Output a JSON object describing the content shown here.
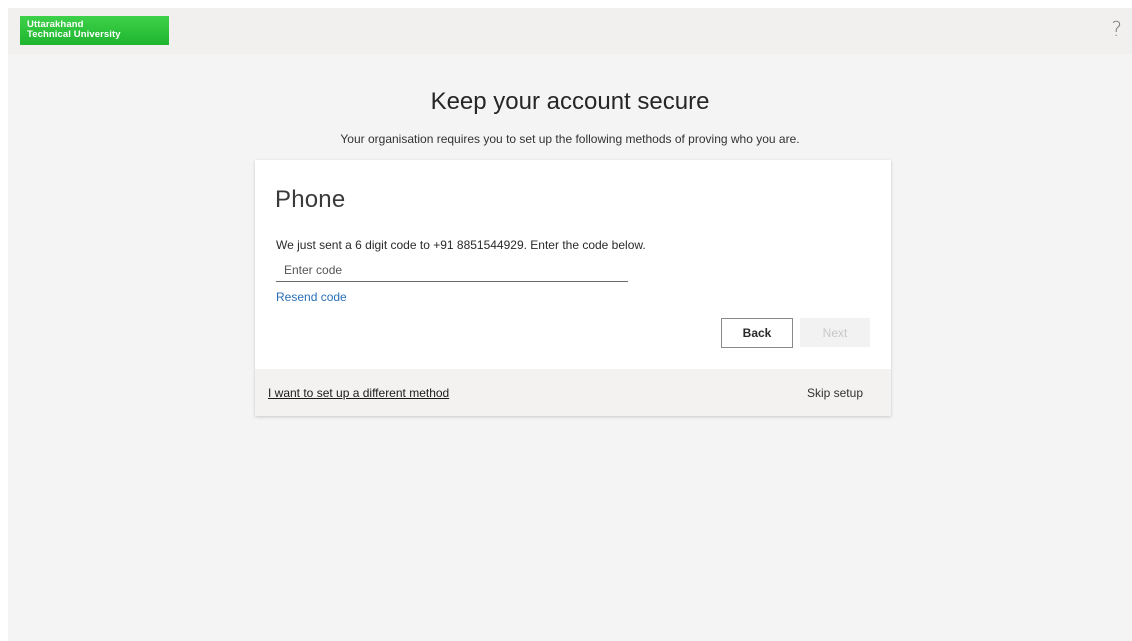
{
  "header": {
    "logo_line1": "Uttarakhand",
    "logo_line2": "Technical University",
    "help_glyph": "?"
  },
  "page": {
    "title": "Keep your account secure",
    "subtitle": "Your organisation requires you to set up the following methods of proving who you are."
  },
  "card": {
    "heading": "Phone",
    "description": "We just sent a 6 digit code to +91 8851544929. Enter the code below.",
    "code_input": {
      "value": "",
      "placeholder": "Enter code"
    },
    "resend_link": "Resend code",
    "back_button": "Back",
    "next_button": "Next"
  },
  "footer": {
    "different_method_link": "I want to set up a different method",
    "skip_link": "Skip setup"
  },
  "colors": {
    "logo_green": "#2ec43c",
    "link_blue": "#2a6fb6",
    "background": "#f4f4f4",
    "card": "#ffffff",
    "footer_strip": "#f3f2f1"
  },
  "icons": {
    "help": "question-mark-icon"
  }
}
